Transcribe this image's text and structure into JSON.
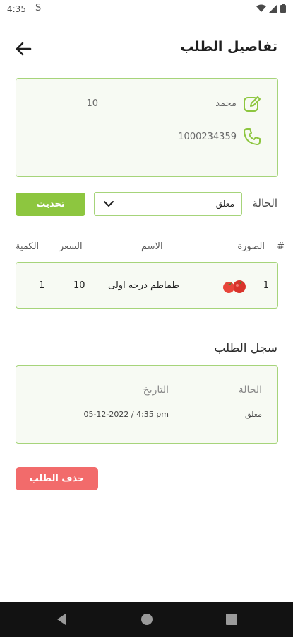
{
  "status_bar": {
    "time": "4:35",
    "sync_symbol": "S"
  },
  "header": {
    "title": "تفاصيل الطلب"
  },
  "customer": {
    "name": "محمد",
    "value": "10",
    "phone": "1000234359"
  },
  "order_status": {
    "label": "الحالة",
    "selected": "معلق",
    "update_label": "تحديث"
  },
  "table": {
    "headers": {
      "number": "#",
      "image": "الصورة",
      "name": "الاسم",
      "price": "السعر",
      "quantity": "الكمية"
    },
    "rows": [
      {
        "number": "1",
        "name": "طماطم درجه اولى",
        "price": "10",
        "quantity": "1"
      }
    ]
  },
  "log": {
    "title": "سجل الطلب",
    "headers": {
      "status": "الحالة",
      "date": "التاريخ"
    },
    "entries": [
      {
        "status": "معلق",
        "date": "05-12-2022 / 4:35 pm"
      }
    ]
  },
  "actions": {
    "delete_label": "حذف الطلب"
  },
  "colors": {
    "accent": "#8dc63f",
    "danger": "#f26b6b",
    "card_border": "#a6d47a"
  }
}
